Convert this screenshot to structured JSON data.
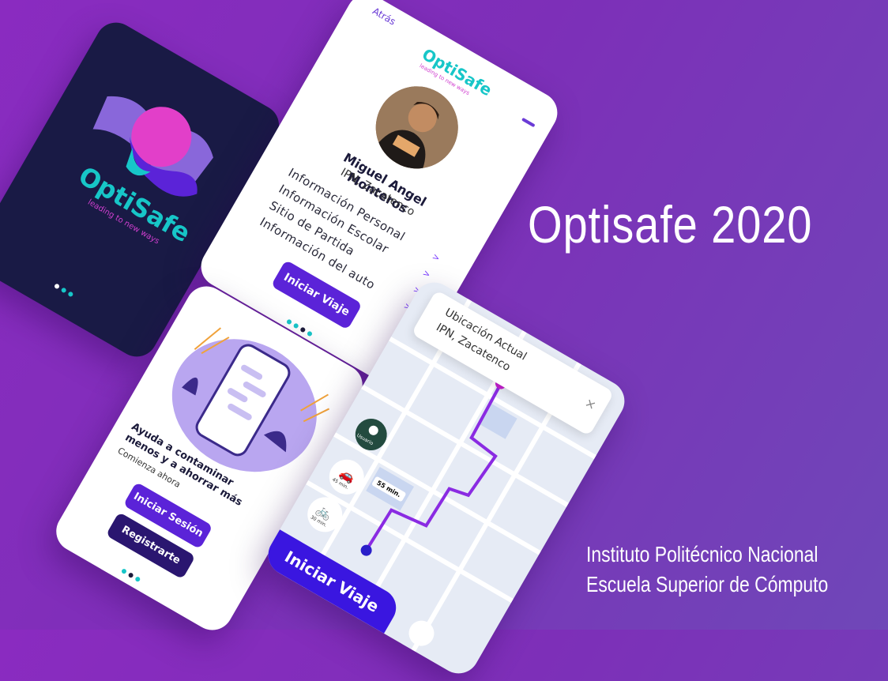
{
  "headline": "Optisafe 2020",
  "institution": {
    "line1": "Instituto Politécnico Nacional",
    "line2": "Escuela Superior de Cómputo"
  },
  "splash": {
    "brand": "OptiSafe",
    "tagline": "leading to new ways"
  },
  "profile": {
    "back_label": "Atrás",
    "brand": "OptiSafe",
    "tagline": "leading to new ways",
    "name": "Miguel Angel Monteros",
    "school": "IPN, Zacatenco",
    "menu": [
      "Información Personal",
      "Información Escolar",
      "Sitio de Partida",
      "Información del auto"
    ],
    "chevron": ">",
    "cta": "Iniciar Viaje"
  },
  "welcome": {
    "heading_line1": "Ayuda a contaminar",
    "heading_line2": "menos y a ahorrar más",
    "subheading": "Comienza ahora",
    "login_button": "Iniciar Sesión",
    "register_button": "Registrarte"
  },
  "map": {
    "location_label": "Ubicación Actual",
    "location_value": "IPN, Zacatenco",
    "user_label": "Usuario",
    "car_time": "45 min.",
    "bike_time": "30 min.",
    "route_time": "55 min.",
    "cta": "Iniciar Viaje",
    "close": "×"
  },
  "colors": {
    "accent": "#5b23d8",
    "brand_teal": "#17c6c8",
    "brand_pink": "#e23fc9",
    "dark_navy": "#191a45",
    "route": "#8a2be2"
  }
}
